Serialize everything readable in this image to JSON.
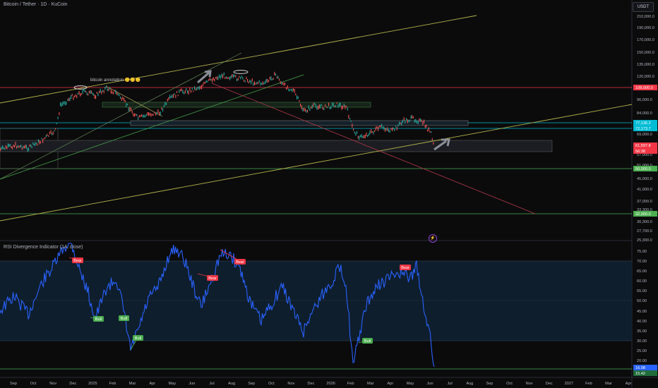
{
  "header": {
    "title": "Bitcoin / Tether · 1D · KuCoin",
    "currency": "USDT"
  },
  "annotation": "bitcoin annotation 🙃🙃🙃",
  "price_axis": {
    "ticks": [
      "210,000.0",
      "190,000.0",
      "170,000.0",
      "150,000.0",
      "135,000.0",
      "120,000.0",
      "96,000.0",
      "84,000.0",
      "69,000.0",
      "57,000.0",
      "51,000.0",
      "45,000.0",
      "41,000.0",
      "37,000.0",
      "33,300.0",
      "30,300.0",
      "27,700.0",
      "25,300.0"
    ],
    "labels": [
      {
        "text": "108,000.0",
        "color": "#f23645"
      },
      {
        "text": "77,136.2",
        "color": "#00bcd4"
      },
      {
        "text": "72,173.7",
        "color": "#00bcd4"
      },
      {
        "text": "61,597.8",
        "color": "#f23645"
      },
      {
        "text": "56:38",
        "color": "#f23645"
      },
      {
        "text": "50,000.0",
        "color": "#4caf50"
      },
      {
        "text": "32,000.0",
        "color": "#4caf50"
      }
    ]
  },
  "rsi": {
    "title": "RSI Divergence Indicator (14, close)",
    "ticks": [
      "75.00",
      "70.00",
      "65.00",
      "60.00",
      "55.00",
      "50.00",
      "45.00",
      "40.00",
      "35.00",
      "30.00",
      "25.00",
      "20.00"
    ],
    "current": "16.08",
    "current2": "15.42",
    "signals": [
      {
        "text": "Bear",
        "type": "bear"
      },
      {
        "text": "Bear",
        "type": "bear"
      },
      {
        "text": "Bear",
        "type": "bear"
      },
      {
        "text": "Bear",
        "type": "bear"
      },
      {
        "text": "Bull",
        "type": "bull"
      },
      {
        "text": "Bull",
        "type": "bull"
      },
      {
        "text": "Bull",
        "type": "bull"
      },
      {
        "text": "Bull",
        "type": "bull"
      }
    ]
  },
  "time_axis": [
    "Sep",
    "Oct",
    "Nov",
    "Dec",
    "2025",
    "Feb",
    "Mar",
    "Apr",
    "May",
    "Jun",
    "Jul",
    "Aug",
    "Sep",
    "Oct",
    "Nov",
    "Dec",
    "2026",
    "Feb",
    "Mar",
    "Apr",
    "May",
    "Jun",
    "Jul",
    "Aug",
    "Sep",
    "Oct",
    "Nov",
    "Dec",
    "2027",
    "Feb",
    "Mar",
    "Apr"
  ],
  "colors": {
    "background": "#0b0b0c",
    "rsi_line": "#2962ff",
    "bear": "#f23645",
    "bull": "#4caf50",
    "trend_yellow": "#b4b44b",
    "trend_green": "#4caf50",
    "trend_red": "#b23a48",
    "cyan": "#00bcd4"
  }
}
